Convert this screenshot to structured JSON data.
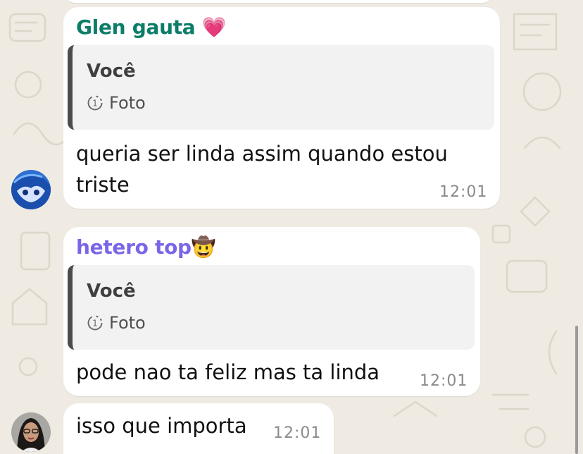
{
  "messages": [
    {
      "sender": "Glen gauta",
      "sender_emoji": "💗",
      "sender_color": "#0c7d68",
      "quote": {
        "author": "Você",
        "type": "Foto"
      },
      "text_lines": [
        "queria ser linda assim quando estou",
        "triste"
      ],
      "time": "12:01"
    },
    {
      "sender": "hetero top",
      "sender_emoji": "🤠",
      "sender_color": "#7b65e7",
      "quote": {
        "author": "Você",
        "type": "Foto"
      },
      "text_lines": [
        "pode nao ta feliz mas ta linda"
      ],
      "time": "12:01"
    },
    {
      "text_lines": [
        "isso que importa"
      ],
      "time": "12:01"
    }
  ],
  "icons": {
    "view_once": "view-once-icon",
    "avatar_1": "anime-avatar",
    "avatar_2": "girl-avatar"
  }
}
